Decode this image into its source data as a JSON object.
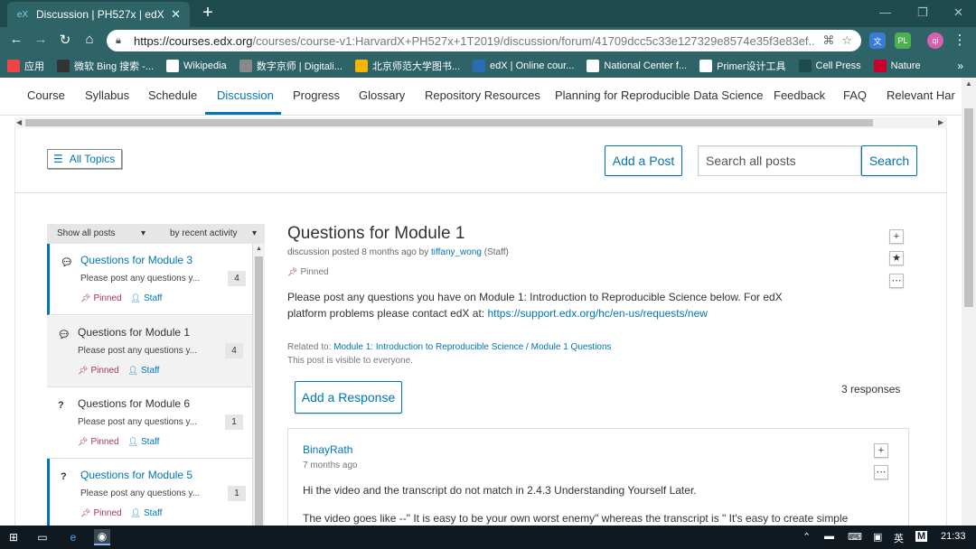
{
  "browser": {
    "tab_title": "Discussion | PH527x | edX",
    "new_tab": "+",
    "url_host": "https://courses.edx.org",
    "url_path": "/courses/course-v1:HarvardX+PH527x+1T2019/discussion/forum/41709dcc5c33e127329e8574e35f3e83ef...",
    "bookmarks": [
      {
        "label": "应用",
        "icon": "apps-icon",
        "color": "#e44"
      },
      {
        "label": "微软 Bing 搜索 -...",
        "icon": "bing-icon",
        "color": "#333"
      },
      {
        "label": "Wikipedia",
        "icon": "wikipedia-icon",
        "color": "#fff"
      },
      {
        "label": "数字京师 | Digitali...",
        "icon": "globe-icon",
        "color": "#888"
      },
      {
        "label": "北京师范大学图书...",
        "icon": "library-icon",
        "color": "#f7b500"
      },
      {
        "label": "edX | Online cour...",
        "icon": "edx-icon",
        "color": "#2b6cb0"
      },
      {
        "label": "National Center f...",
        "icon": "ncbi-icon",
        "color": "#fff"
      },
      {
        "label": "Primer设计工具",
        "icon": "primer-icon",
        "color": "#fff"
      },
      {
        "label": "Cell Press",
        "icon": "cellpress-icon",
        "color": "#1f4b4f"
      },
      {
        "label": "Nature",
        "icon": "nature-icon",
        "color": "#c9002b"
      }
    ],
    "bookmarks_more": "»"
  },
  "course_nav": {
    "items": [
      "Course",
      "Syllabus",
      "Schedule",
      "Discussion",
      "Progress",
      "Glossary",
      "Repository Resources",
      "Planning for Reproducible Data Science",
      "Feedback",
      "FAQ",
      "Relevant Har"
    ],
    "active": "Discussion"
  },
  "header": {
    "all_topics": "All Topics",
    "add_post": "Add a Post",
    "search_placeholder": "Search all posts",
    "search_button": "Search"
  },
  "list": {
    "filter": "Show all posts",
    "sort": "by recent activity",
    "posts": [
      {
        "title": "Questions for Module 3",
        "excerpt": "Please post any questions y...",
        "count": "4",
        "pinned": "Pinned",
        "staff": "Staff",
        "type": "discussion"
      },
      {
        "title": "Questions for Module 1",
        "excerpt": "Please post any questions y...",
        "count": "4",
        "pinned": "Pinned",
        "staff": "Staff",
        "type": "discussion"
      },
      {
        "title": "Questions for Module 6",
        "excerpt": "Please post any questions y...",
        "count": "1",
        "pinned": "Pinned",
        "staff": "Staff",
        "type": "question"
      },
      {
        "title": "Questions for Module 5",
        "excerpt": "Please post any questions y...",
        "count": "1",
        "pinned": "Pinned",
        "staff": "Staff",
        "type": "question"
      }
    ]
  },
  "thread": {
    "title": "Questions for Module 1",
    "meta_prefix": "discussion posted 8 months ago by",
    "author": "tiffany_wong",
    "author_role": "(Staff)",
    "pinned": "Pinned",
    "body_text": "Please post any questions you have on Module 1: Introduction to Reproducible Science below. For edX platform problems please contact edX at:",
    "body_link": "https://support.edx.org/hc/en-us/requests/new",
    "related_prefix": "Related to:",
    "related_link": "Module 1: Introduction to Reproducible Science / Module 1 Questions",
    "visibility": "This post is visible to everyone.",
    "add_response": "Add a Response",
    "responses_count": "3 responses"
  },
  "response": {
    "author": "BinayRath",
    "time": "7 months ago",
    "para1": "Hi the video and the transcript do not match in 2.4.3 Understanding Yourself Later.",
    "para2": "The video goes like --\" It is easy to be your own worst enemy\" whereas the transcript is \" It's easy to create simple"
  },
  "taskbar": {
    "ime": "英",
    "time": "21:33"
  },
  "colors": {
    "edx_blue": "#0075b4",
    "pinned": "#a2385a",
    "chrome_toolbar": "#2e6468"
  }
}
